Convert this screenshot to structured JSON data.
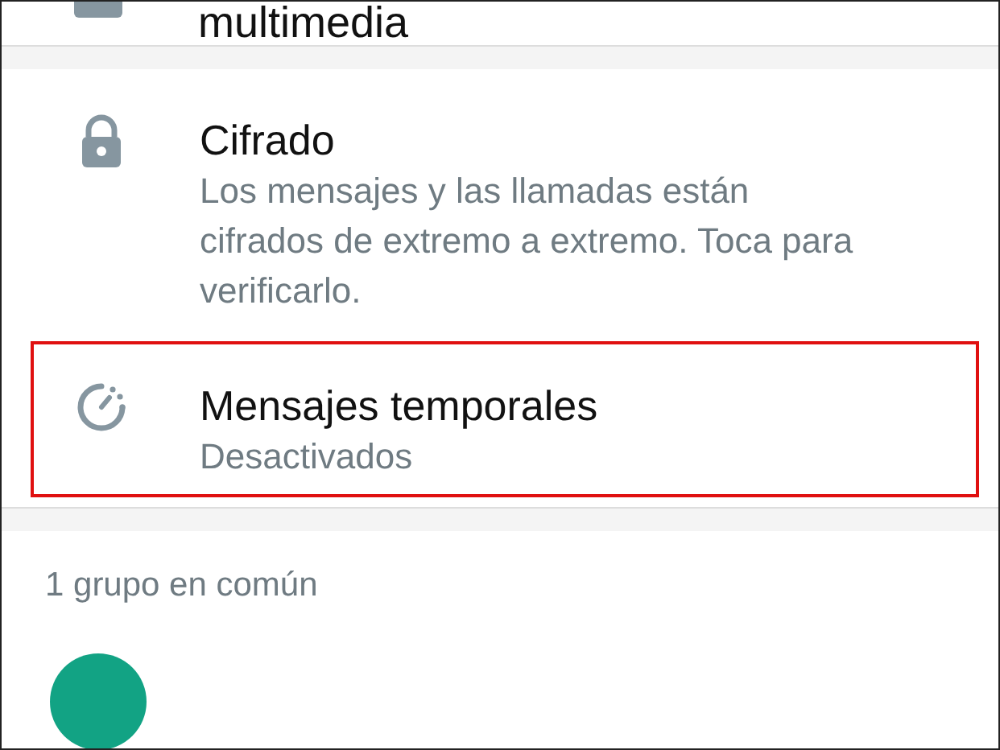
{
  "media_row": {
    "title_tail": "multimedia"
  },
  "settings": [
    {
      "kind": "lock",
      "title": "Cifrado",
      "subtitle": "Los mensajes y las llamadas están cifrados de extremo a extremo. Toca para verificarlo.",
      "highlighted": false
    },
    {
      "kind": "timer",
      "title": "Mensajes temporales",
      "subtitle": "Desactivados",
      "highlighted": true
    }
  ],
  "groups": {
    "heading": "1 grupo en común"
  }
}
